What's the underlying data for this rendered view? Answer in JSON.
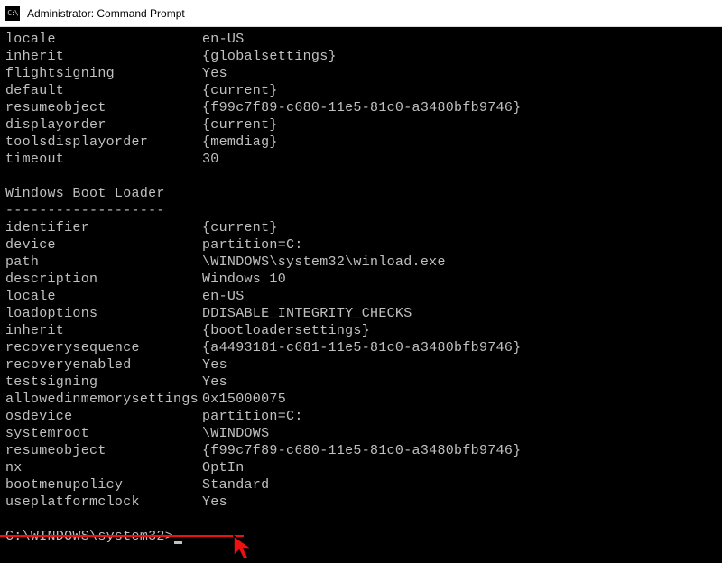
{
  "titlebar": {
    "label": "Administrator: Command Prompt"
  },
  "bootmgr_tail": [
    {
      "key": "locale",
      "value": "en-US"
    },
    {
      "key": "inherit",
      "value": "{globalsettings}"
    },
    {
      "key": "flightsigning",
      "value": "Yes"
    },
    {
      "key": "default",
      "value": "{current}"
    },
    {
      "key": "resumeobject",
      "value": "{f99c7f89-c680-11e5-81c0-a3480bfb9746}"
    },
    {
      "key": "displayorder",
      "value": "{current}"
    },
    {
      "key": "toolsdisplayorder",
      "value": "{memdiag}"
    },
    {
      "key": "timeout",
      "value": "30"
    }
  ],
  "section": {
    "title": "Windows Boot Loader",
    "divider": "-------------------"
  },
  "loader": [
    {
      "key": "identifier",
      "value": "{current}"
    },
    {
      "key": "device",
      "value": "partition=C:"
    },
    {
      "key": "path",
      "value": "\\WINDOWS\\system32\\winload.exe"
    },
    {
      "key": "description",
      "value": "Windows 10"
    },
    {
      "key": "locale",
      "value": "en-US"
    },
    {
      "key": "loadoptions",
      "value": "DDISABLE_INTEGRITY_CHECKS"
    },
    {
      "key": "inherit",
      "value": "{bootloadersettings}"
    },
    {
      "key": "recoverysequence",
      "value": "{a4493181-c681-11e5-81c0-a3480bfb9746}"
    },
    {
      "key": "recoveryenabled",
      "value": "Yes"
    },
    {
      "key": "testsigning",
      "value": "Yes"
    },
    {
      "key": "allowedinmemorysettings",
      "value": "0x15000075"
    },
    {
      "key": "osdevice",
      "value": "partition=C:"
    },
    {
      "key": "systemroot",
      "value": "\\WINDOWS"
    },
    {
      "key": "resumeobject",
      "value": "{f99c7f89-c680-11e5-81c0-a3480bfb9746}"
    },
    {
      "key": "nx",
      "value": "OptIn"
    },
    {
      "key": "bootmenupolicy",
      "value": "Standard"
    },
    {
      "key": "useplatformclock",
      "value": "Yes"
    }
  ],
  "prompt": "C:\\WINDOWS\\system32>"
}
